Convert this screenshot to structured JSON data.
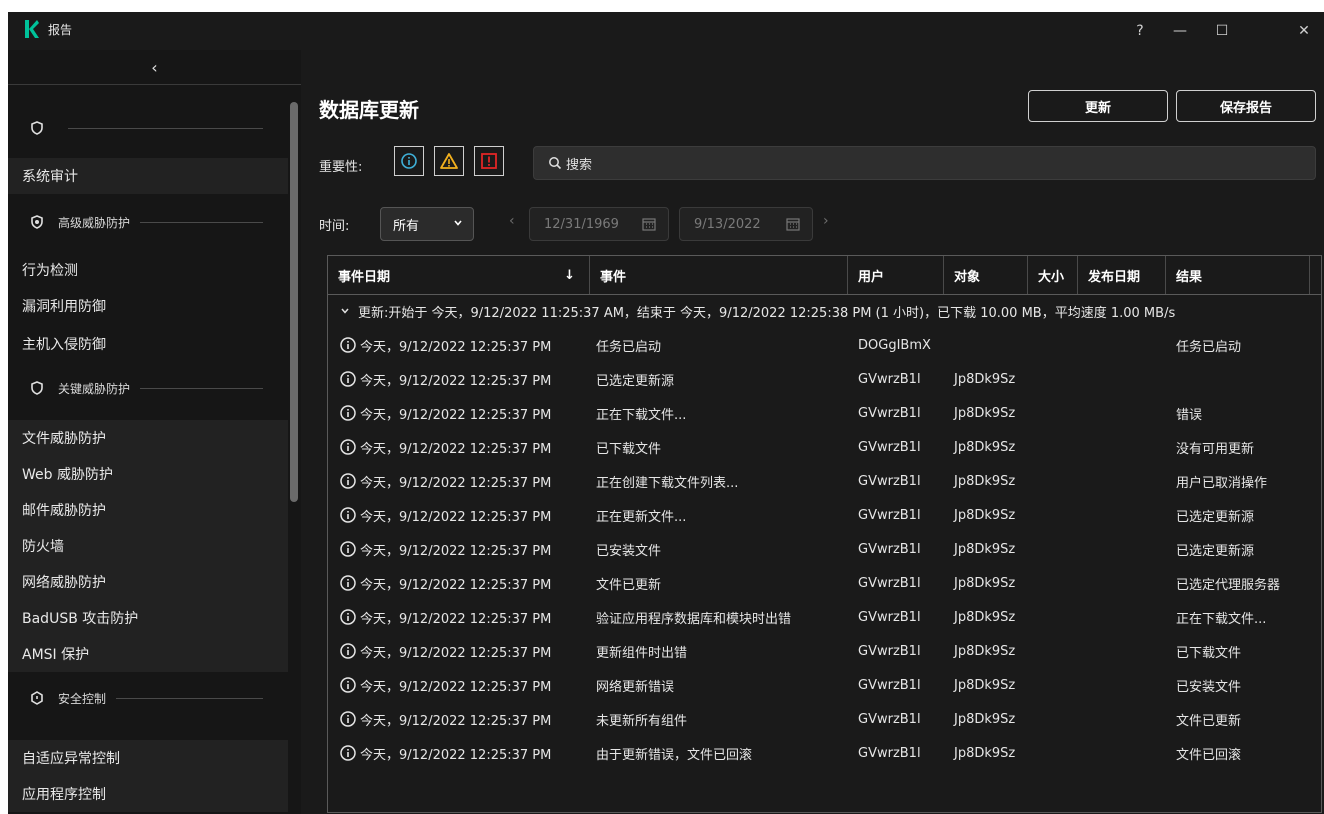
{
  "window": {
    "title": "报告",
    "help": "?",
    "minimize": "—",
    "maximize": "☐",
    "close": "✕"
  },
  "sidebar": {
    "collapse": "‹",
    "sections": [
      {
        "id": "top",
        "label": "",
        "icon": "shield-icon"
      },
      {
        "id": "advanced",
        "label": "高级威胁防护",
        "icon": "shield-badge-icon"
      },
      {
        "id": "key",
        "label": "关键威胁防护",
        "icon": "shield-icon"
      },
      {
        "id": "security",
        "label": "安全控制",
        "icon": "security-control-icon"
      }
    ],
    "items": [
      "系统审计",
      "行为检测",
      "漏洞利用防御",
      "主机入侵防御",
      "文件威胁防护",
      "Web 威胁防护",
      "邮件威胁防护",
      "防火墙",
      "网络威胁防护",
      "BadUSB 攻击防护",
      "AMSI 保护",
      "自适应异常控制",
      "应用程序控制"
    ]
  },
  "main": {
    "title": "数据库更新",
    "buttons": {
      "update": "更新",
      "save_report": "保存报告"
    },
    "severity": {
      "label": "重要性:",
      "info_icon": "info-icon",
      "warning_icon": "warning-icon",
      "critical_icon": "critical-icon"
    },
    "search": {
      "placeholder": "搜索"
    },
    "time": {
      "label": "时间:",
      "selected": "所有",
      "from_date": "12/31/1969",
      "to_date": "9/13/2022"
    },
    "colors": {
      "info": "#3fb0d8",
      "warning": "#f2b01e",
      "critical": "#e02626"
    }
  },
  "table": {
    "columns": [
      "事件日期",
      "事件",
      "用户",
      "对象",
      "大小",
      "发布日期",
      "结果"
    ],
    "sort_indicator": "↓",
    "group": "更新:开始于 今天，9/12/2022 11:25:37 AM，结束于 今天，9/12/2022 12:25:38 PM (1 小时)，已下载 10.00 MB，平均速度 1.00 MB/s",
    "rows": [
      {
        "date": "今天，9/12/2022 12:25:37 PM",
        "event": "任务已启动",
        "user": "DOGgIBmX",
        "object": "",
        "result": "任务已启动"
      },
      {
        "date": "今天，9/12/2022 12:25:37 PM",
        "event": "已选定更新源",
        "user": "GVwrzB1l",
        "object": "Jp8Dk9Sz",
        "result": ""
      },
      {
        "date": "今天，9/12/2022 12:25:37 PM",
        "event": "正在下载文件...",
        "user": "GVwrzB1l",
        "object": "Jp8Dk9Sz",
        "result": "错误"
      },
      {
        "date": "今天，9/12/2022 12:25:37 PM",
        "event": "已下载文件",
        "user": "GVwrzB1l",
        "object": "Jp8Dk9Sz",
        "result": "没有可用更新"
      },
      {
        "date": "今天，9/12/2022 12:25:37 PM",
        "event": "正在创建下载文件列表...",
        "user": "GVwrzB1l",
        "object": "Jp8Dk9Sz",
        "result": "用户已取消操作"
      },
      {
        "date": "今天，9/12/2022 12:25:37 PM",
        "event": "正在更新文件...",
        "user": "GVwrzB1l",
        "object": "Jp8Dk9Sz",
        "result": "已选定更新源"
      },
      {
        "date": "今天，9/12/2022 12:25:37 PM",
        "event": "已安装文件",
        "user": "GVwrzB1l",
        "object": "Jp8Dk9Sz",
        "result": "已选定更新源"
      },
      {
        "date": "今天，9/12/2022 12:25:37 PM",
        "event": "文件已更新",
        "user": "GVwrzB1l",
        "object": "Jp8Dk9Sz",
        "result": "已选定代理服务器"
      },
      {
        "date": "今天，9/12/2022 12:25:37 PM",
        "event": "验证应用程序数据库和模块时出错",
        "user": "GVwrzB1l",
        "object": "Jp8Dk9Sz",
        "result": "正在下载文件..."
      },
      {
        "date": "今天，9/12/2022 12:25:37 PM",
        "event": "更新组件时出错",
        "user": "GVwrzB1l",
        "object": "Jp8Dk9Sz",
        "result": "已下载文件"
      },
      {
        "date": "今天，9/12/2022 12:25:37 PM",
        "event": "网络更新错误",
        "user": "GVwrzB1l",
        "object": "Jp8Dk9Sz",
        "result": "已安装文件"
      },
      {
        "date": "今天，9/12/2022 12:25:37 PM",
        "event": "未更新所有组件",
        "user": "GVwrzB1l",
        "object": "Jp8Dk9Sz",
        "result": "文件已更新"
      },
      {
        "date": "今天，9/12/2022 12:25:37 PM",
        "event": "由于更新错误，文件已回滚",
        "user": "GVwrzB1l",
        "object": "Jp8Dk9Sz",
        "result": "文件已回滚"
      }
    ]
  }
}
